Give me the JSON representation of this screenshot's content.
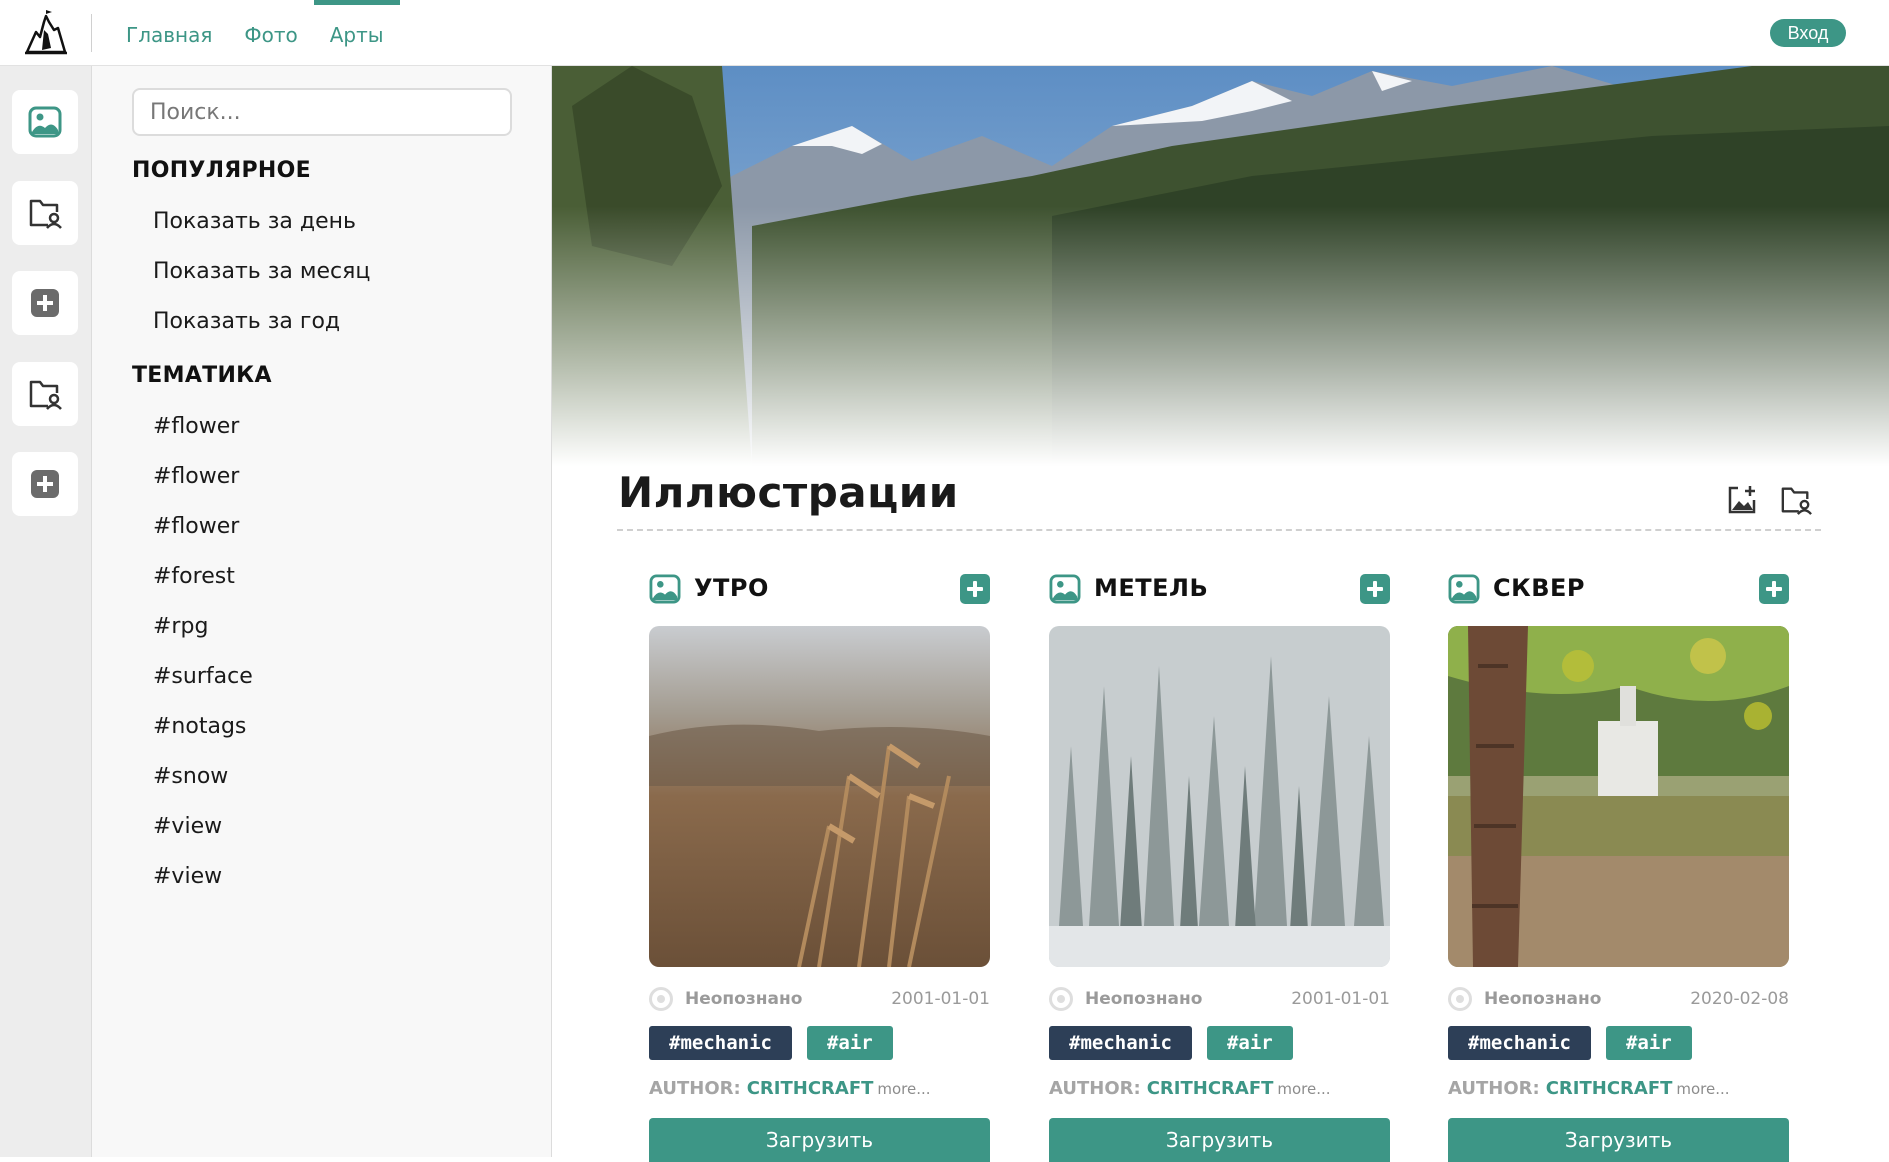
{
  "nav": {
    "items": [
      {
        "label": "Главная",
        "active": false
      },
      {
        "label": "Фото",
        "active": false
      },
      {
        "label": "Арты",
        "active": true
      }
    ],
    "login_label": "Вход"
  },
  "rail": {
    "icons": [
      "image-icon",
      "folder-user-icon",
      "plus-icon",
      "folder-user-icon",
      "plus-icon"
    ]
  },
  "sidebar": {
    "search_placeholder": "Поиск...",
    "popular_heading": "ПОПУЛЯРНОЕ",
    "popular_items": [
      "Показать за день",
      "Показать за месяц",
      "Показать за год"
    ],
    "topics_heading": "ТЕМАТИКА",
    "topics": [
      "#flower",
      "#flower",
      "#flower",
      "#forest",
      "#rpg",
      "#surface",
      "#notags",
      "#snow",
      "#view",
      "#view"
    ]
  },
  "main": {
    "title": "Иллюстрации",
    "cards": [
      {
        "title": "УТРО",
        "user": "Неопознано",
        "date": "2001-01-01",
        "tags": [
          "#mechanic",
          "#air"
        ],
        "author_label": "AUTHOR:",
        "author": "CRITHCRAFT",
        "more": "more...",
        "button": "Загрузить"
      },
      {
        "title": "МЕТЕЛЬ",
        "user": "Неопознано",
        "date": "2001-01-01",
        "tags": [
          "#mechanic",
          "#air"
        ],
        "author_label": "AUTHOR:",
        "author": "CRITHCRAFT",
        "more": "more...",
        "button": "Загрузить"
      },
      {
        "title": "СКВЕР",
        "user": "Неопознано",
        "date": "2020-02-08",
        "tags": [
          "#mechanic",
          "#air"
        ],
        "author_label": "AUTHOR:",
        "author": "CRITHCRAFT",
        "more": "more...",
        "button": "Загрузить"
      }
    ]
  },
  "colors": {
    "accent": "#3d9686",
    "tag_dark": "#2d3f57",
    "rail_bg": "#ededed",
    "sidebar_bg": "#f8f8f8"
  }
}
